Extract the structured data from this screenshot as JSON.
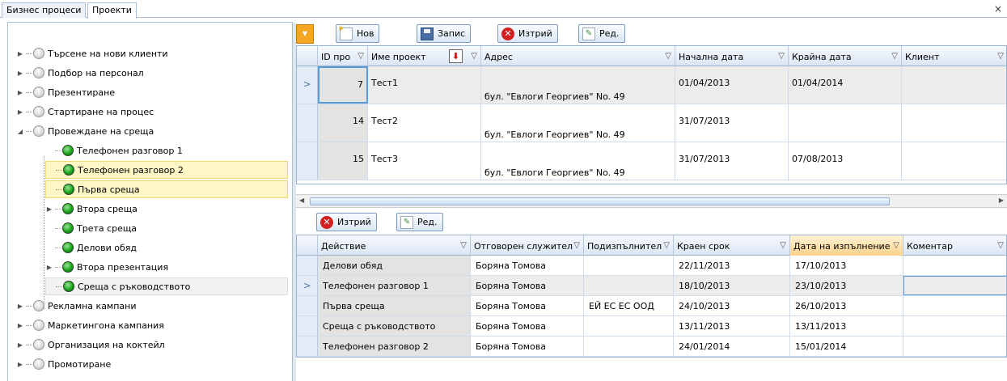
{
  "tabs": {
    "business": "Бизнес процеси",
    "projects": "Проекти"
  },
  "close_symbol": "×",
  "tree": {
    "items": [
      {
        "label": "Търсене на нови клиенти",
        "level": 0,
        "expandable": true,
        "status": "grey"
      },
      {
        "label": "Подбор на персонал",
        "level": 0,
        "expandable": true,
        "status": "grey"
      },
      {
        "label": "Презентиране",
        "level": 0,
        "expandable": true,
        "status": "grey"
      },
      {
        "label": "Стартиране на процес",
        "level": 0,
        "expandable": true,
        "status": "grey"
      },
      {
        "label": "Провеждане на среща",
        "level": 0,
        "expanded": true,
        "status": "grey"
      },
      {
        "label": "Телефонен разговор 1",
        "level": 1,
        "expandable": false,
        "status": "green"
      },
      {
        "label": "Телефонен разговор 2",
        "level": 1,
        "expandable": false,
        "status": "green",
        "selected": true
      },
      {
        "label": "Първа среща",
        "level": 1,
        "expandable": false,
        "status": "green",
        "selected": true
      },
      {
        "label": "Втора среща",
        "level": 1,
        "expandable": true,
        "status": "green"
      },
      {
        "label": "Трета среща",
        "level": 1,
        "expandable": false,
        "status": "green"
      },
      {
        "label": "Делови обяд",
        "level": 1,
        "expandable": false,
        "status": "green"
      },
      {
        "label": "Втора презентация",
        "level": 1,
        "expandable": true,
        "status": "green"
      },
      {
        "label": "Среща с ръководството",
        "level": 1,
        "expandable": false,
        "status": "green",
        "focused": true
      },
      {
        "label": "Рекламна кампани",
        "level": 0,
        "expandable": true,
        "status": "grey"
      },
      {
        "label": "Маркетингона кампания",
        "level": 0,
        "expandable": true,
        "status": "grey"
      },
      {
        "label": "Организация на коктейл",
        "level": 0,
        "expandable": true,
        "status": "grey"
      },
      {
        "label": "Промотиране",
        "level": 0,
        "expandable": true,
        "status": "grey"
      }
    ]
  },
  "top_toolbar": {
    "new": "Нов",
    "save": "Запис",
    "delete": "Изтрий",
    "edit": "Ред."
  },
  "projects_grid": {
    "columns": [
      "ID про",
      "Име проект",
      "Адрес",
      "Начална дата",
      "Крайна дата",
      "Клиент"
    ],
    "rows": [
      {
        "id": "7",
        "name": "Тест1",
        "address": "бул. \"Евлоги Георгиев\" No. 49",
        "start": "01/04/2013",
        "end": "01/04/2014",
        "client": "",
        "current": true
      },
      {
        "id": "14",
        "name": "Тест2",
        "address": "бул. \"Евлоги Георгиев\" No. 49",
        "start": "31/07/2013",
        "end": "",
        "client": ""
      },
      {
        "id": "15",
        "name": "Тест3",
        "address": "бул. \"Евлоги Георгиев\" No. 49",
        "start": "31/07/2013",
        "end": "07/08/2013",
        "client": ""
      }
    ]
  },
  "bottom_toolbar": {
    "delete": "Изтрий",
    "edit": "Ред."
  },
  "actions_grid": {
    "columns": [
      "Действие",
      "Отговорен служител",
      "Подизпълнител",
      "Краен срок",
      "Дата на изпълнение",
      "Коментар"
    ],
    "rows": [
      {
        "action": "Делови обяд",
        "responsible": "Боряна Томова",
        "sub": "",
        "deadline": "22/11/2013",
        "done": "17/10/2013",
        "comment": ""
      },
      {
        "action": "Телефонен разговор 1",
        "responsible": "Боряна Томова",
        "sub": "",
        "deadline": "18/10/2013",
        "done": "23/10/2013",
        "comment": "",
        "current": true
      },
      {
        "action": "Първа среща",
        "responsible": "Боряна Томова",
        "sub": "ЕЙ ЕС ЕС ООД",
        "deadline": "24/10/2013",
        "done": "26/10/2013",
        "comment": ""
      },
      {
        "action": "Среща с ръководството",
        "responsible": "Боряна Томова",
        "sub": "",
        "deadline": "13/11/2013",
        "done": "13/11/2013",
        "comment": ""
      },
      {
        "action": "Телефонен разговор 2",
        "responsible": "Боряна Томова",
        "sub": "",
        "deadline": "24/01/2014",
        "done": "15/01/2014",
        "comment": ""
      }
    ]
  },
  "colors": {
    "selected_bg": "#fef6c4",
    "accent": "#f5a623",
    "header": "#dbe6f3"
  }
}
